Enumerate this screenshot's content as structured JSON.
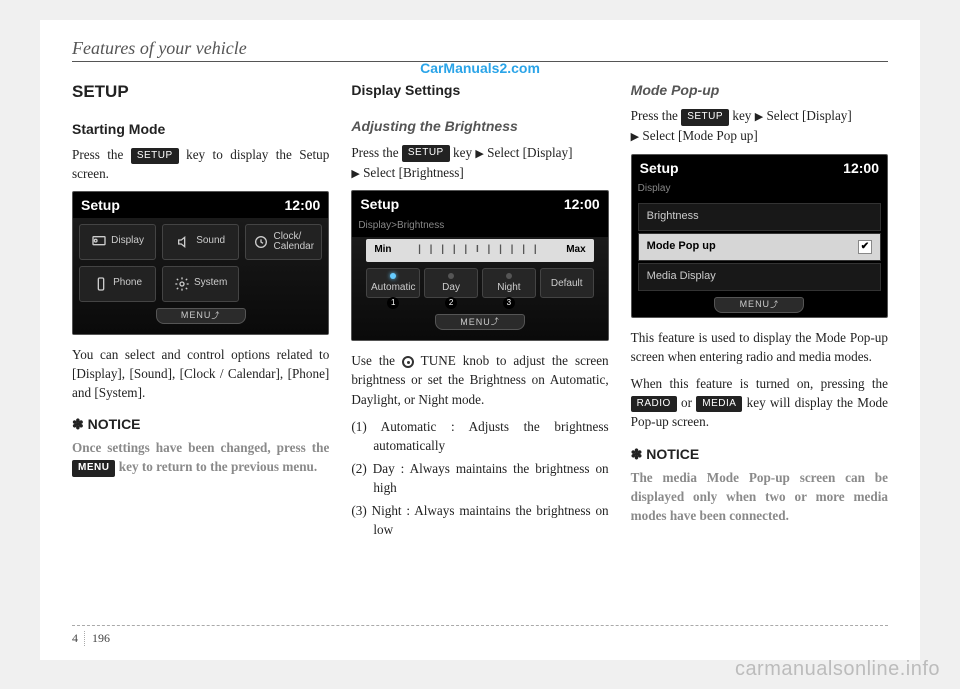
{
  "header": {
    "title": "Features of your vehicle"
  },
  "watermark_top": "CarManuals2.com",
  "watermark_bottom": "carmanualsonline.info",
  "footer": {
    "chapter": "4",
    "page": "196"
  },
  "col1": {
    "h2": "SETUP",
    "h3": "Starting Mode",
    "p1a": "Press the ",
    "p1_key": "SETUP",
    "p1b": " key to display the Setup screen.",
    "shot": {
      "title": "Setup",
      "clock": "12:00",
      "tiles": [
        "Display",
        "Sound",
        "Clock/\nCalendar",
        "Phone",
        "System"
      ],
      "menu": "MENU"
    },
    "p2": "You can select and control options related to [Display], [Sound], [Clock / Calendar], [Phone] and [System].",
    "notice_h": "NOTICE",
    "notice_a": "Once settings have been changed, press the ",
    "notice_key": "MENU",
    "notice_b": " key to return to the previous menu."
  },
  "col2": {
    "h3": "Display Settings",
    "h4": "Adjusting the Brightness",
    "p1a": "Press the ",
    "p1_key": "SETUP",
    "p1b": " key",
    "p1c": "Select [Display] ",
    "p1d": "Select [Brightness]",
    "shot": {
      "title": "Setup",
      "clock": "12:00",
      "crumb": "Display>Brightness",
      "min": "Min",
      "max": "Max",
      "segs": [
        "Automatic",
        "Day",
        "Night"
      ],
      "default": "Default",
      "menu": "MENU"
    },
    "p2a": "Use the ",
    "p2b": " TUNE knob to adjust the screen brightness or set the Brightness on Automatic, Daylight, or Night mode.",
    "list": [
      "(1) Automatic : Adjusts the brightness automatically",
      "(2) Day : Always maintains the brightness on high",
      "(3) Night : Always maintains the brightness on low"
    ]
  },
  "col3": {
    "h4": "Mode Pop-up",
    "p1a": "Press the ",
    "p1_key": "SETUP",
    "p1b": " key",
    "p1c": "Select [Display] ",
    "p1d": "Select [Mode Pop up]",
    "shot": {
      "title": "Setup",
      "clock": "12:00",
      "crumb": "Display",
      "rows": [
        "Brightness",
        "Mode Pop up",
        "Media Display"
      ],
      "selected_index": 1,
      "menu": "MENU"
    },
    "p2": "This feature is used to display the Mode Pop-up screen when entering radio and media modes.",
    "p3a": "When this feature is turned on, pressing the ",
    "p3_key1": "RADIO",
    "p3_mid": " or ",
    "p3_key2": "MEDIA",
    "p3b": " key will display the Mode Pop-up screen.",
    "notice_h": "NOTICE",
    "notice": "The media Mode Pop-up screen can be displayed only when two or more media modes have been connected."
  }
}
